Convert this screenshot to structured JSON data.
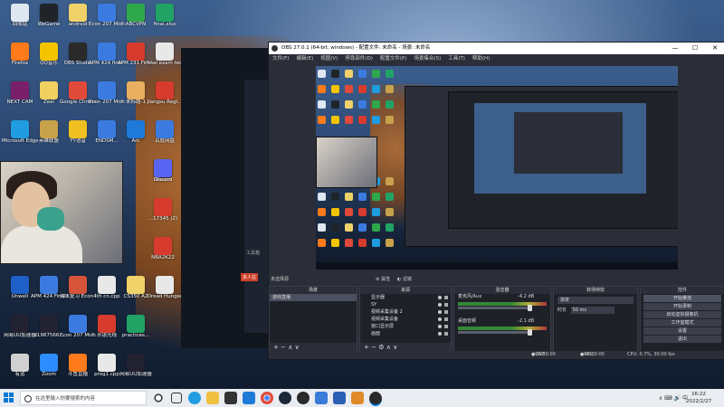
{
  "desktop": {
    "icons": [
      {
        "label": "回收站",
        "color": "#dfe7f0",
        "col": 0,
        "row": 0
      },
      {
        "label": "WeGame",
        "color": "#202428",
        "col": 1,
        "row": 0
      },
      {
        "label": "android",
        "color": "#f0d26a",
        "col": 2,
        "row": 0
      },
      {
        "label": "Econ 207 Midterm II...",
        "color": "#3b7be0",
        "col": 3,
        "row": 0
      },
      {
        "label": "ABCVPN",
        "color": "#2ea84a",
        "col": 4,
        "row": 0
      },
      {
        "label": "final.xlsx",
        "color": "#21a366",
        "col": 5,
        "row": 0
      },
      {
        "label": "Firefox",
        "color": "#ff7a1a",
        "col": 0,
        "row": 1
      },
      {
        "label": "QQ音乐",
        "color": "#f4c400",
        "col": 1,
        "row": 1
      },
      {
        "label": "OBS Studio",
        "color": "#2a2a2a",
        "col": 2,
        "row": 1
      },
      {
        "label": "APM 424 final .pdf",
        "color": "#3b7be0",
        "col": 3,
        "row": 1
      },
      {
        "label": "APM 231 Final Scor...",
        "color": "#d63b2e",
        "col": 4,
        "row": 1
      },
      {
        "label": "final exam test171...",
        "color": "#e8e8e8",
        "col": 5,
        "row": 1
      },
      {
        "label": "NEXT CAM",
        "color": "#7a1f6a",
        "col": 0,
        "row": 2
      },
      {
        "label": "Zeal",
        "color": "#f0d060",
        "col": 1,
        "row": 2
      },
      {
        "label": "Google Chrome",
        "color": "#e04a3a",
        "col": 2,
        "row": 2
      },
      {
        "label": "Econ 207 Midterm II...",
        "color": "#3b7be0",
        "col": 3,
        "row": 2
      },
      {
        "label": "未标题-1",
        "color": "#e8b060",
        "col": 4,
        "row": 2
      },
      {
        "label": "Jiangsu Regi...",
        "color": "#d63b2e",
        "col": 5,
        "row": 2
      },
      {
        "label": "Microsoft Edge",
        "color": "#1f9de0",
        "col": 0,
        "row": 3
      },
      {
        "label": "英雄联盟",
        "color": "#c8a24a",
        "col": 1,
        "row": 3
      },
      {
        "label": "YY语音",
        "color": "#f0c020",
        "col": 2,
        "row": 3
      },
      {
        "label": "ENDSM...",
        "color": "#3b7be0",
        "col": 3,
        "row": 3
      },
      {
        "label": "Arc",
        "color": "#1e7ad8",
        "col": 4,
        "row": 3
      },
      {
        "label": "百度网盘",
        "color": "#3b7be0",
        "col": 5,
        "row": 3
      },
      {
        "label": "Unwell",
        "color": "#1f5fc8",
        "col": 0,
        "row": 7
      },
      {
        "label": "APM 424 Final.docx",
        "color": "#3b7be0",
        "col": 1,
        "row": 7
      },
      {
        "label": "期末复习 Econ 207...",
        "color": "#d6543a",
        "col": 2,
        "row": 7
      },
      {
        "label": "4th cn.cpp",
        "color": "#e8e8e8",
        "col": 3,
        "row": 7
      },
      {
        "label": "CS350 A2",
        "color": "#f0d26a",
        "col": 4,
        "row": 7
      },
      {
        "label": "Dread Hunger",
        "color": "#e8e8e8",
        "col": 5,
        "row": 7
      },
      {
        "label": "网易UU加速器",
        "color": "#223",
        "col": 0,
        "row": 8
      },
      {
        "label": "d1987566...",
        "color": "#223",
        "col": 1,
        "row": 8
      },
      {
        "label": "Econ 207 Midterm...",
        "color": "#3b7be0",
        "col": 2,
        "row": 8
      },
      {
        "label": "水银光线",
        "color": "#d63b2e",
        "col": 3,
        "row": 8
      },
      {
        "label": "practices...",
        "color": "#21a366",
        "col": 4,
        "row": 8
      },
      {
        "label": "有道",
        "color": "#d0d0d0",
        "col": 0,
        "row": 9
      },
      {
        "label": "Zoom",
        "color": "#2d8cff",
        "col": 1,
        "row": 9
      },
      {
        "label": "斗鱼直播",
        "color": "#ff7a1a",
        "col": 2,
        "row": 9
      },
      {
        "label": "prog1.cpp",
        "color": "#e8e8e8",
        "col": 3,
        "row": 9
      },
      {
        "label": "网易UU加速器",
        "color": "#223",
        "col": 4,
        "row": 9
      }
    ],
    "side_icons": [
      {
        "label": "Steam",
        "color": "#1b2838",
        "row": 4
      },
      {
        "label": "Discord",
        "color": "#5865f2",
        "row": 4
      },
      {
        "label": "...17345 (2)",
        "color": "#d63b2e",
        "row": 5
      },
      {
        "label": "NBA2K22",
        "color": "#d63b2e",
        "row": 6
      }
    ]
  },
  "dark_app": {
    "label_1": "工具箱",
    "label_2": "多人在"
  },
  "obs": {
    "title": "OBS 27.0.1 (64-bit, windows) - 配置文件: 未命名 - 场景: 未命名",
    "window_controls": [
      "—",
      "☐",
      "✕"
    ],
    "menu": [
      "文件(F)",
      "编辑(E)",
      "视图(V)",
      "停靠部件(D)",
      "配置文件(P)",
      "场景集合(S)",
      "工具(T)",
      "帮助(H)"
    ],
    "dock_bar": {
      "scene_label": "未选择源",
      "properties": "属性",
      "filters": "滤镜"
    },
    "scenes": {
      "header": "场景",
      "items": [
        "游戏直播"
      ]
    },
    "sources": {
      "header": "来源",
      "items": [
        "显示器",
        "SY",
        "视频采集设备 2",
        "视频采集设备",
        "窗口显示屏",
        "画面"
      ]
    },
    "mixer": {
      "header": "混音器",
      "channels": [
        {
          "name": "麦克风/Aux",
          "db": "-4.2 dB"
        },
        {
          "name": "桌面音频",
          "db": "-2.1 dB"
        }
      ]
    },
    "transitions": {
      "header": "转场特效",
      "type": "渐变",
      "duration_label": "时长",
      "duration_value": "50 ms"
    },
    "controls": {
      "header": "控件",
      "buttons": [
        "开始推流",
        "开始录制",
        "启动虚拟摄像机",
        "工作室模式",
        "设置",
        "退出"
      ]
    },
    "status": {
      "live_label": "LIVE:",
      "live_time": "00:00:00",
      "rec_label": "REC:",
      "rec_time": "00:00:00",
      "cpu": "CPU: 0.7%, 30.00 fps"
    }
  },
  "taskbar": {
    "search_placeholder": "在这里输入你要搜索的内容",
    "tray": "∧  ⌨  🔊  中",
    "time": "16:22",
    "date": "2022/2/27"
  }
}
